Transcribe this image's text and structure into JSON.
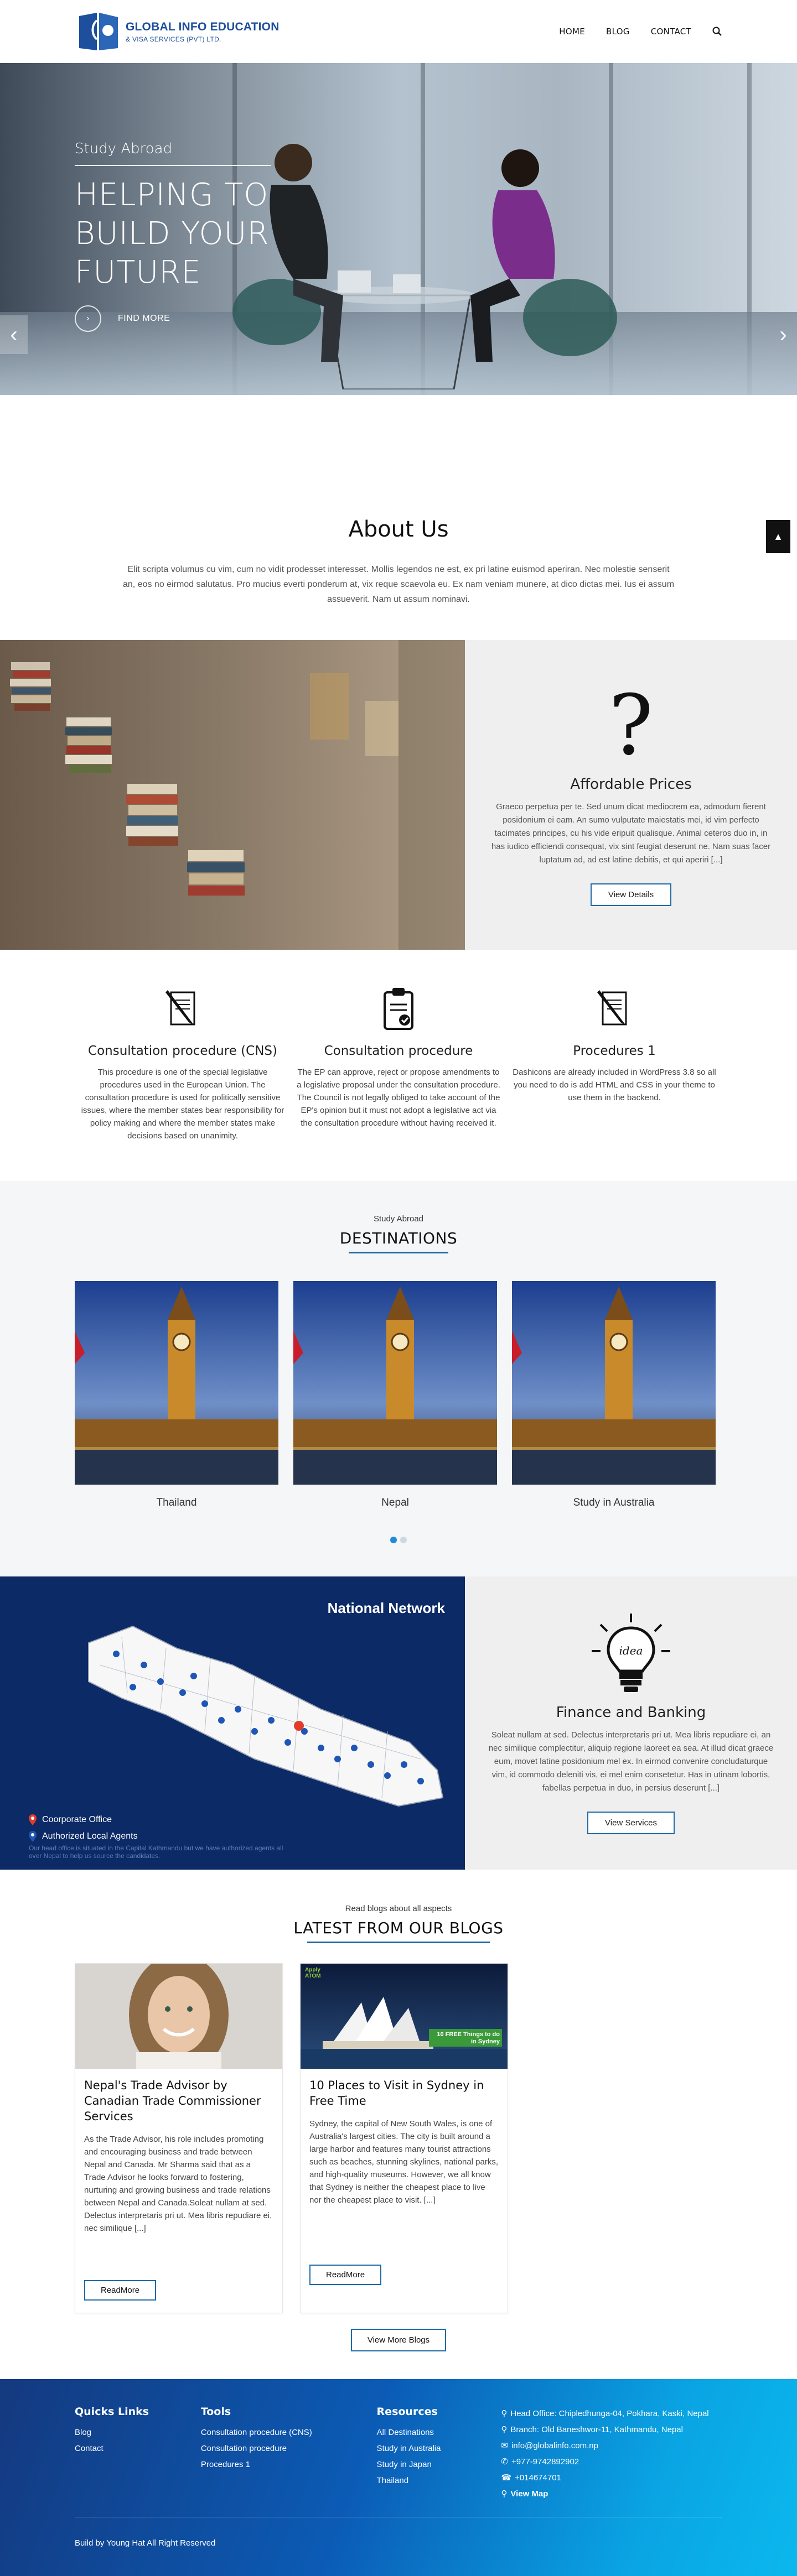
{
  "header": {
    "logo_title": "GLOBAL INFO EDUCATION",
    "logo_sub": "& VISA SERVICES (PVT) LTD.",
    "nav": [
      "HOME",
      "BLOG",
      "CONTACT"
    ]
  },
  "hero": {
    "small": "Study Abroad",
    "big_line1": "HELPING TO",
    "big_line2": "BUILD YOUR",
    "big_line3": "FUTURE",
    "more": "FIND MORE"
  },
  "about": {
    "title": "About Us",
    "text": "Elit scripta volumus cu vim, cum no vidit prodesset interesset. Mollis legendos ne est, ex pri latine euismod aperiran. Nec molestie senserit an, eos no eirmod salutatus. Pro mucius everti ponderum at, vix reque scaevola eu. Ex nam veniam munere, at dico dictas mei. Ius ei assum assueverit. Nam ut assum nominavi."
  },
  "feature1": {
    "glyph": "?",
    "title": "Affordable Prices",
    "text": "Graeco perpetua per te. Sed unum dicat mediocrem ea, admodum fierent posidonium ei eam. An sumo vulputate maiestatis mei, id vim perfecto tacimates principes, cu his vide eripuit qualisque. Animal ceteros duo in, in has iudico efficiendi consequat, vix sint feugiat deserunt ne. Nam suas facer luptatum ad, ad est latine debitis, et qui aperiri [...]",
    "button": "View Details"
  },
  "procedures": [
    {
      "title": "Consultation procedure (CNS)",
      "text": "This procedure is one of the special legislative procedures used in the European Union. The consultation procedure is used for politically sensitive issues, where the member states bear responsibility for policy making and where the member states make decisions based on unanimity."
    },
    {
      "title": "Consultation procedure",
      "text": "The EP can approve, reject or propose amendments to a legislative proposal under the consultation procedure. The Council is not legally obliged to take account of the EP's opinion but it must not adopt a legislative act via the consultation procedure without having received it."
    },
    {
      "title": "Procedures 1",
      "text": "Dashicons are already included in WordPress 3.8 so all you need to do is add HTML and CSS in your theme to use them in the backend."
    }
  ],
  "destinations": {
    "eyebrow": "Study Abroad",
    "title": "DESTINATIONS",
    "cards": [
      "Thailand",
      "Nepal",
      "Study in Australia"
    ]
  },
  "network": {
    "map_title": "National Network",
    "legend_office": "Coorporate Office",
    "legend_agents": "Authorized Local Agents",
    "map_note": "Our head office is situated in the Capital Kathmandu but we have authorized agents all over Nepal to help us source the candidates.",
    "bulb_word": "idea",
    "title": "Finance and Banking",
    "text": "Soleat nullam at sed. Delectus interpretaris pri ut. Mea libris repudiare ei, an nec similique complectitur, aliquip regione laoreet ea sea. At illud dicat graece eum, movet latine posidonium mel ex. In eirmod convenire concludaturque vim, id commodo deleniti vis, ei mel enim consetetur. Has in utinam lobortis, fabellas perpetua in duo, in persius deserunt [...]",
    "button": "View Services"
  },
  "blogs": {
    "eyebrow": "Read blogs about all aspects",
    "title": "LATEST FROM OUR BLOGS",
    "posts": [
      {
        "title": "Nepal's Trade Advisor by Canadian Trade Commissioner Services",
        "text": "As the Trade Advisor, his role includes promoting and encouraging business and trade between Nepal and Canada. Mr Sharma said that as a Trade Advisor he looks forward to fostering, nurturing and growing business and trade relations between Nepal and Canada.Soleat nullam at sed. Delectus interpretaris pri ut. Mea libris repudiare ei, nec similique [...]",
        "button": "ReadMore"
      },
      {
        "title": "10 Places to Visit in Sydney in Free Time",
        "text": "Sydney, the capital of New South Wales, is one of Australia's largest cities. The city is built around a large harbor and features many tourist attractions such as beaches, stunning skylines, national parks, and high-quality museums. However, we all know that Sydney is neither the cheapest place to live nor the cheapest place to visit. [...]",
        "button": "ReadMore",
        "img_tag": "Apply ATOM",
        "img_caption": "10 FREE Things to do in Sydney"
      }
    ],
    "view_more": "View More Blogs"
  },
  "footer": {
    "quick_title": "Quicks Links",
    "quick": [
      "Blog",
      "Contact"
    ],
    "tools_title": "Tools",
    "tools": [
      "Consultation procedure (CNS)",
      "Consultation procedure",
      "Procedures 1"
    ],
    "resources_title": "Resources",
    "resources": [
      "All Destinations",
      "Study in Australia",
      "Study in Japan",
      "Thailand"
    ],
    "contact": {
      "head_office": "Head Office: Chipledhunga-04, Pokhara, Kaski, Nepal",
      "branch": "Branch: Old Baneshwor-11, Kathmandu, Nepal",
      "email": "info@globalinfo.com.np",
      "phone1": "+977-9742892902",
      "phone2": "+014674701",
      "map": "View Map"
    },
    "copyright": "Build by Young Hat All Right Reserved"
  },
  "colors": {
    "brand_blue": "#1d4f9c",
    "accent_blue": "#1f6aa5",
    "map_navy": "#0c2a66"
  }
}
